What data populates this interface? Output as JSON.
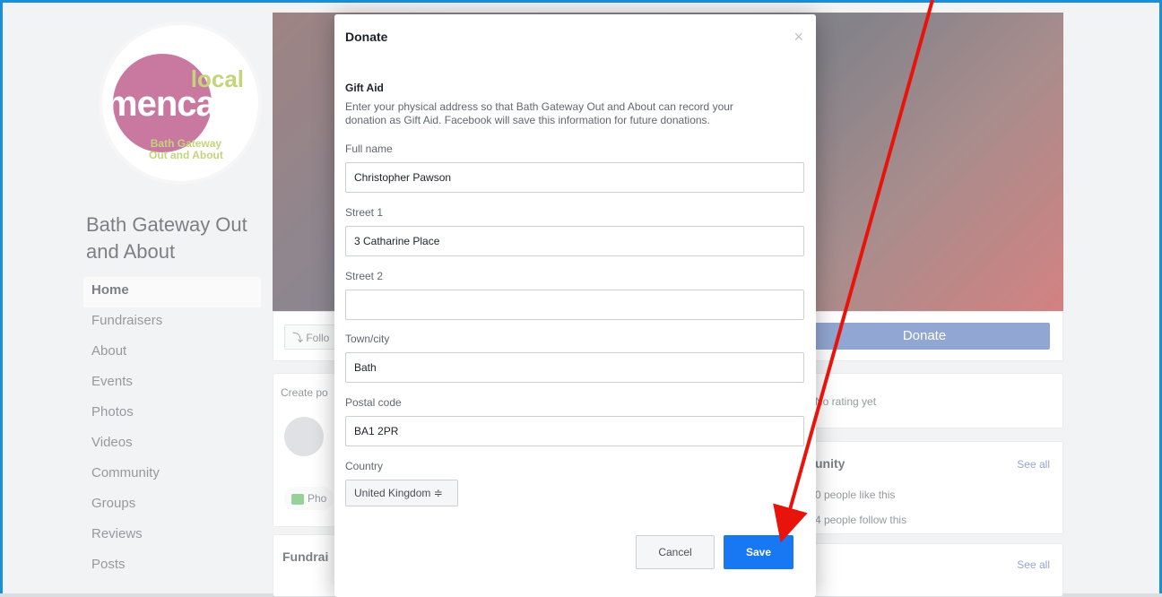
{
  "page": {
    "logo": {
      "local": "local",
      "main_a": "me",
      "main_b": "n",
      "main_c": "cap",
      "sub1": "Bath Gateway",
      "sub2": "Out and About"
    },
    "name": "Bath Gateway Out and About",
    "nav": [
      "Home",
      "Fundraisers",
      "About",
      "Events",
      "Photos",
      "Videos",
      "Community",
      "Groups",
      "Reviews",
      "Posts"
    ],
    "follow_label": "Follo",
    "donate_label": "Donate",
    "create_post": "Create po",
    "photo_label": "Pho",
    "fundraisers_label": "Fundrai",
    "rating": "No rating yet",
    "community_title": "unity",
    "see_all": "See all",
    "likes": "0 people like this",
    "follows": "4 people follow this"
  },
  "modal": {
    "title": "Donate",
    "close": "×",
    "section_title": "Gift Aid",
    "section_desc": "Enter your physical address so that Bath Gateway Out and About can record your donation as Gift Aid. Facebook will save this information for future donations.",
    "fields": {
      "full_name": {
        "label": "Full name",
        "value": "Christopher Pawson"
      },
      "street1": {
        "label": "Street 1",
        "value": "3 Catharine Place"
      },
      "street2": {
        "label": "Street 2",
        "value": ""
      },
      "town": {
        "label": "Town/city",
        "value": "Bath"
      },
      "postal": {
        "label": "Postal code",
        "value": "BA1 2PR"
      }
    },
    "country": {
      "label": "Country",
      "value": "United Kingdom ≑"
    },
    "cancel_label": "Cancel",
    "save_label": "Save"
  },
  "colors": {
    "accent": "#1877f2",
    "arrow": "#e8140c",
    "frame": "#1a8fd8",
    "brand": "#a3195b"
  }
}
